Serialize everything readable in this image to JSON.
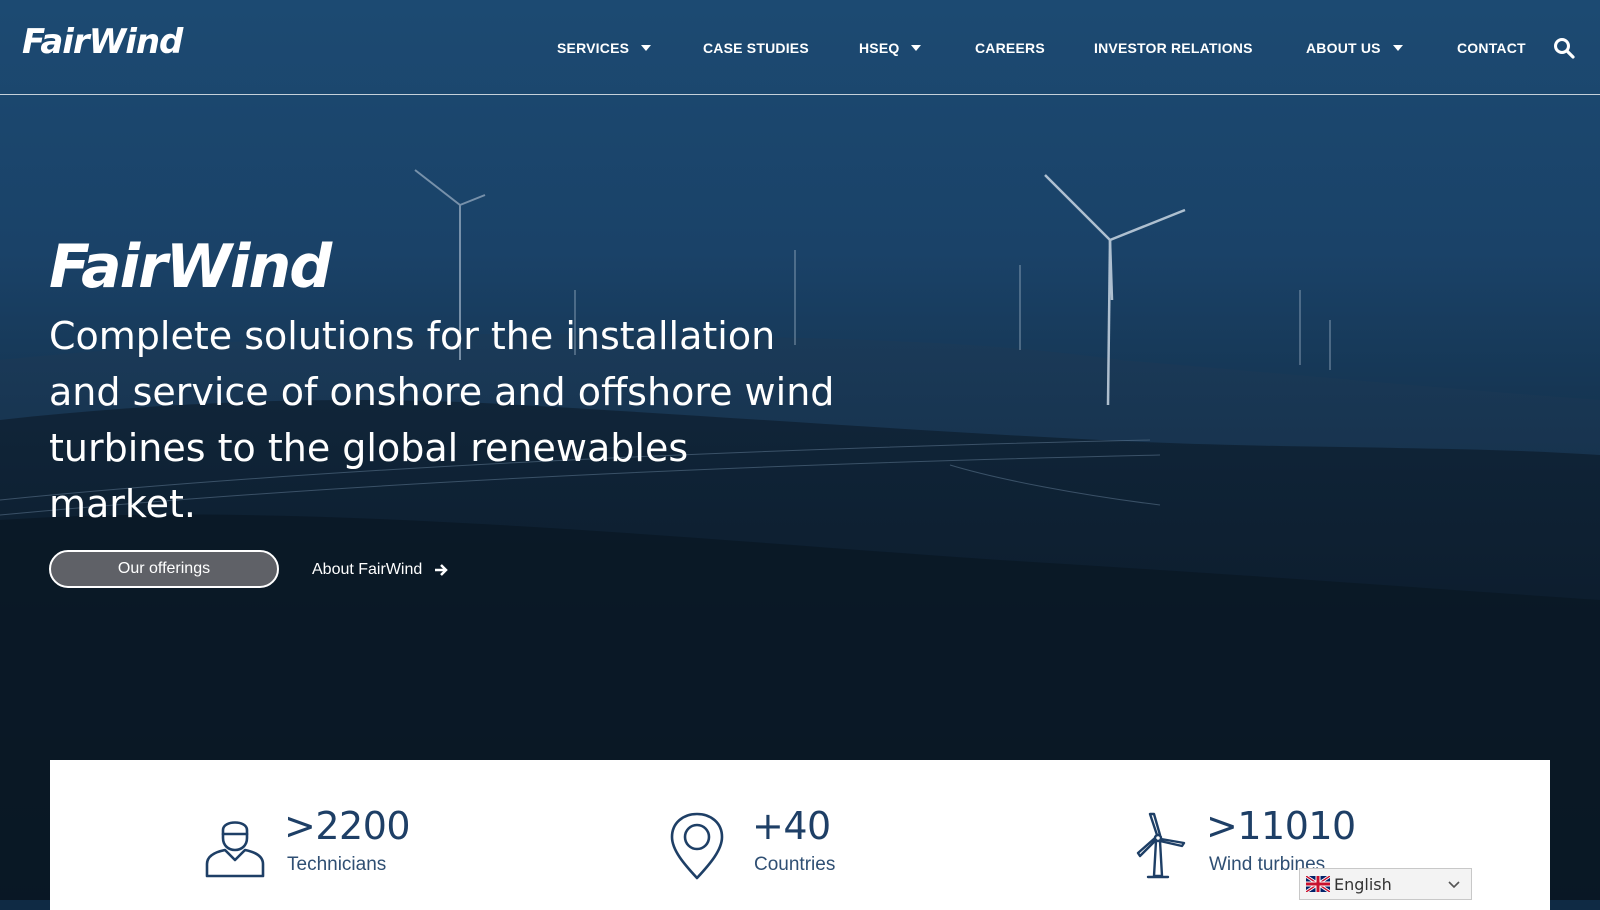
{
  "brand": {
    "logo_text": "FairWind"
  },
  "nav": {
    "items": [
      {
        "label": "SERVICES",
        "has_dropdown": true
      },
      {
        "label": "CASE STUDIES",
        "has_dropdown": false
      },
      {
        "label": "HSEQ",
        "has_dropdown": true
      },
      {
        "label": "CAREERS",
        "has_dropdown": false
      },
      {
        "label": "INVESTOR RELATIONS",
        "has_dropdown": false
      },
      {
        "label": "ABOUT US",
        "has_dropdown": true
      },
      {
        "label": "CONTACT",
        "has_dropdown": false
      }
    ],
    "search_icon": "search-icon"
  },
  "hero": {
    "title": "FairWind",
    "subtitle": "Complete solutions for the installation and service of onshore and offshore wind turbines to the global renewables market.",
    "primary_button": "Our offerings",
    "secondary_link": "About FairWind",
    "secondary_link_icon": "arrow-right-icon"
  },
  "stats": [
    {
      "value": ">2200",
      "label": "Technicians",
      "icon": "technician-icon"
    },
    {
      "value": "+40",
      "label": "Countries",
      "icon": "location-pin-icon"
    },
    {
      "value": ">11010",
      "label": "Wind turbines",
      "icon": "wind-turbine-icon"
    }
  ],
  "language_selector": {
    "selected": "English",
    "flag_icon": "uk-flag-icon"
  },
  "colors": {
    "header_bg": "#1c4a72",
    "stat_text": "#1e3f66",
    "card_bg": "#ffffff"
  }
}
